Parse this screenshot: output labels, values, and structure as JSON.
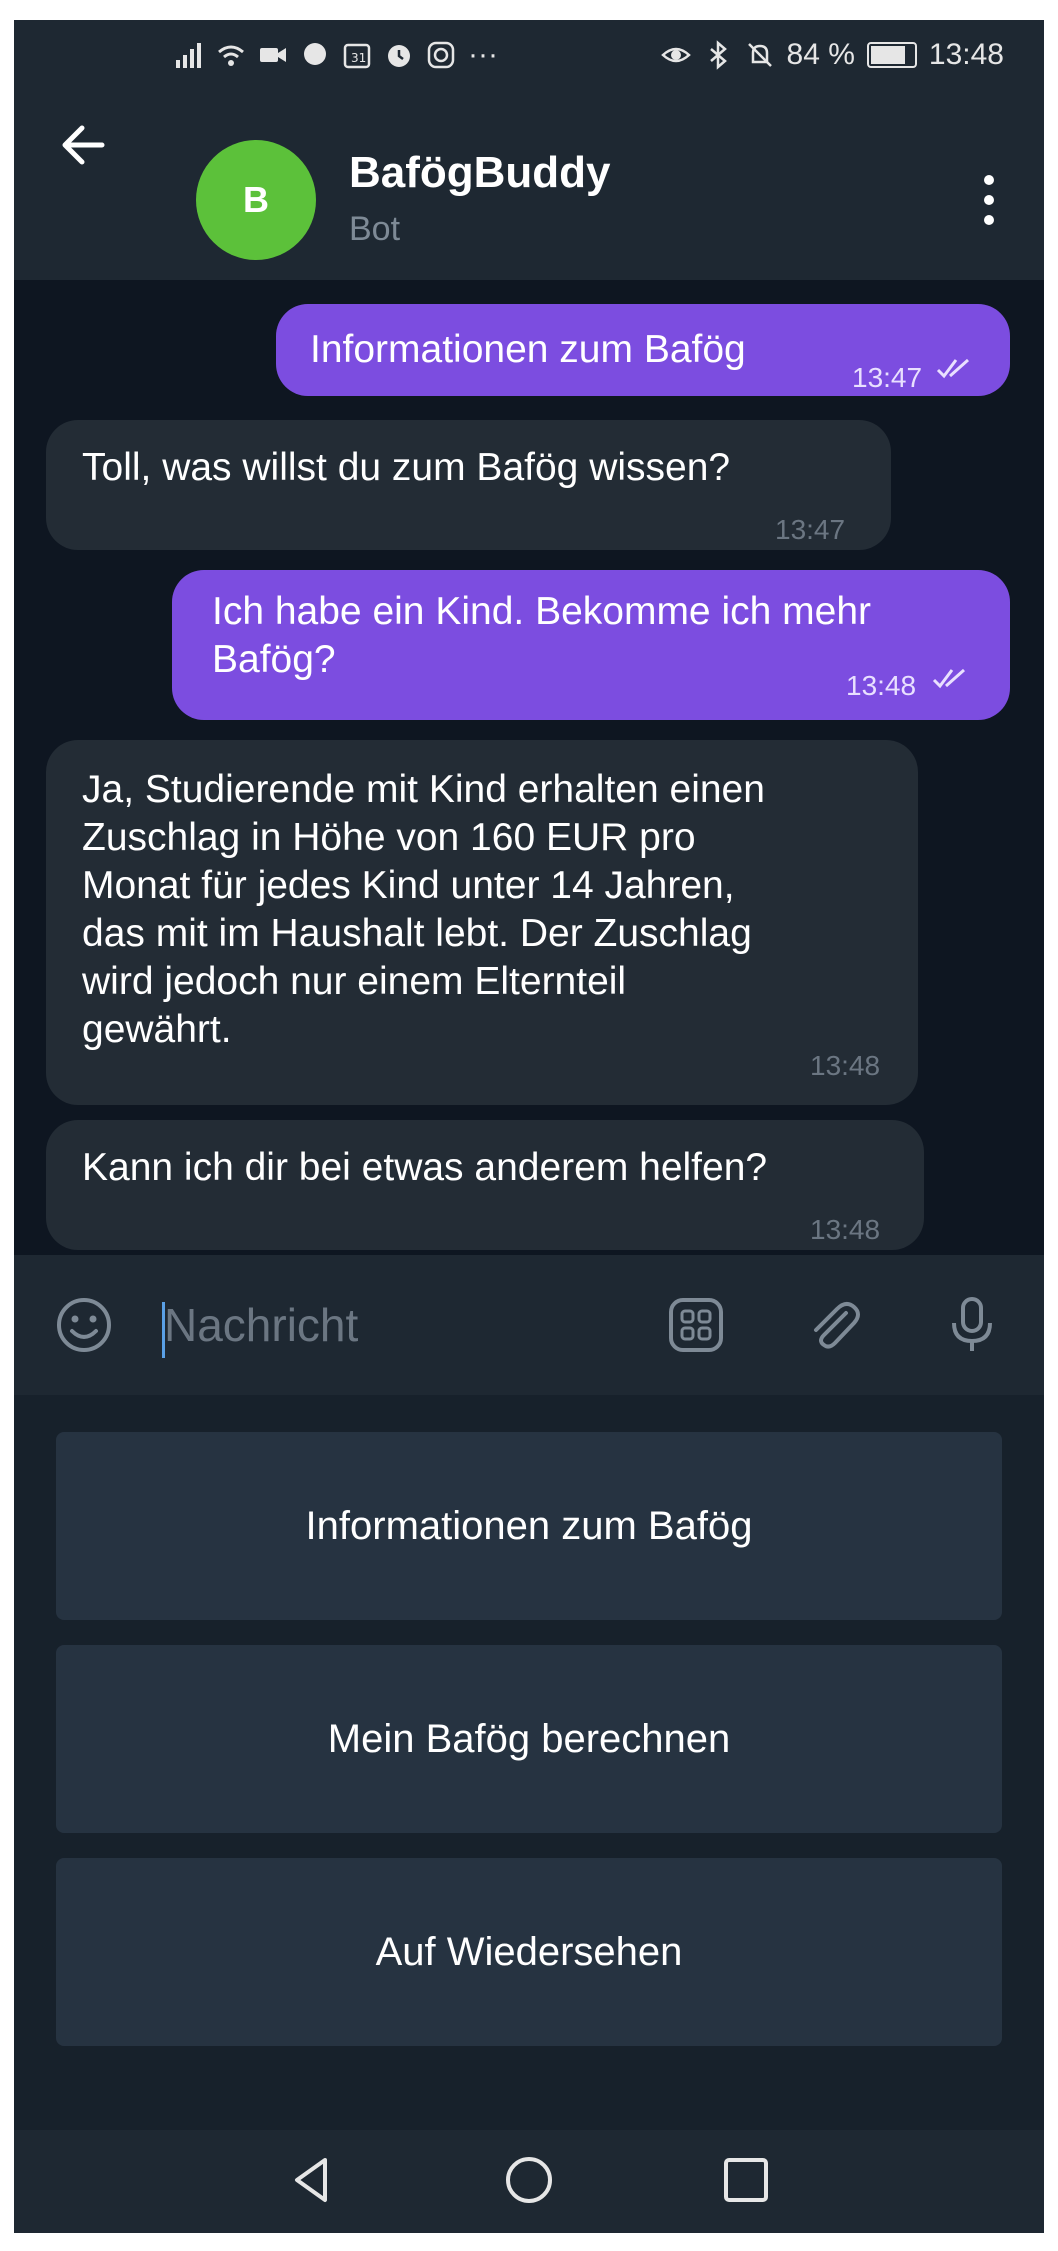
{
  "status_bar": {
    "battery": "84 %",
    "battery_level": 0.84,
    "time": "13:48",
    "overflow": "···"
  },
  "header": {
    "title": "BafögBuddy",
    "subtitle": "Bot",
    "avatar_letter": "B"
  },
  "messages": [
    {
      "direction": "out",
      "text": "Informationen zum Bafög",
      "time": "13:47",
      "read": true
    },
    {
      "direction": "in",
      "text": "Toll, was willst du zum Bafög wissen?",
      "time": "13:47"
    },
    {
      "direction": "out",
      "lines": [
        "Ich habe ein Kind. Bekomme ich mehr",
        "Bafög?"
      ],
      "time": "13:48",
      "read": true
    },
    {
      "direction": "in",
      "lines": [
        "Ja, Studierende mit Kind erhalten einen",
        "Zuschlag in Höhe von 160 EUR pro",
        "Monat für jedes Kind unter 14 Jahren,",
        "das mit im Haushalt lebt. Der Zuschlag",
        "wird jedoch nur einem Elternteil",
        "gewährt."
      ],
      "time": "13:48"
    },
    {
      "direction": "in",
      "text": "Kann ich dir bei etwas anderem helfen?",
      "time": "13:48"
    }
  ],
  "input": {
    "placeholder": "Nachricht"
  },
  "keyboard": {
    "buttons": [
      "Informationen zum Bafög",
      "Mein Bafög berechnen",
      "Auf Wiedersehen"
    ]
  },
  "icons": {
    "back": "arrow-left-icon",
    "menu": "vertical-dots-icon",
    "emoji": "smiley-icon",
    "commands": "grid-icon",
    "attach": "paperclip-icon",
    "mic": "microphone-icon"
  },
  "colors": {
    "outgoing_bubble": "#7c4de0",
    "incoming_bubble": "#232c35",
    "chat_background": "#0e1621",
    "header_background": "#1e2832",
    "avatar": "#5cc13a"
  }
}
